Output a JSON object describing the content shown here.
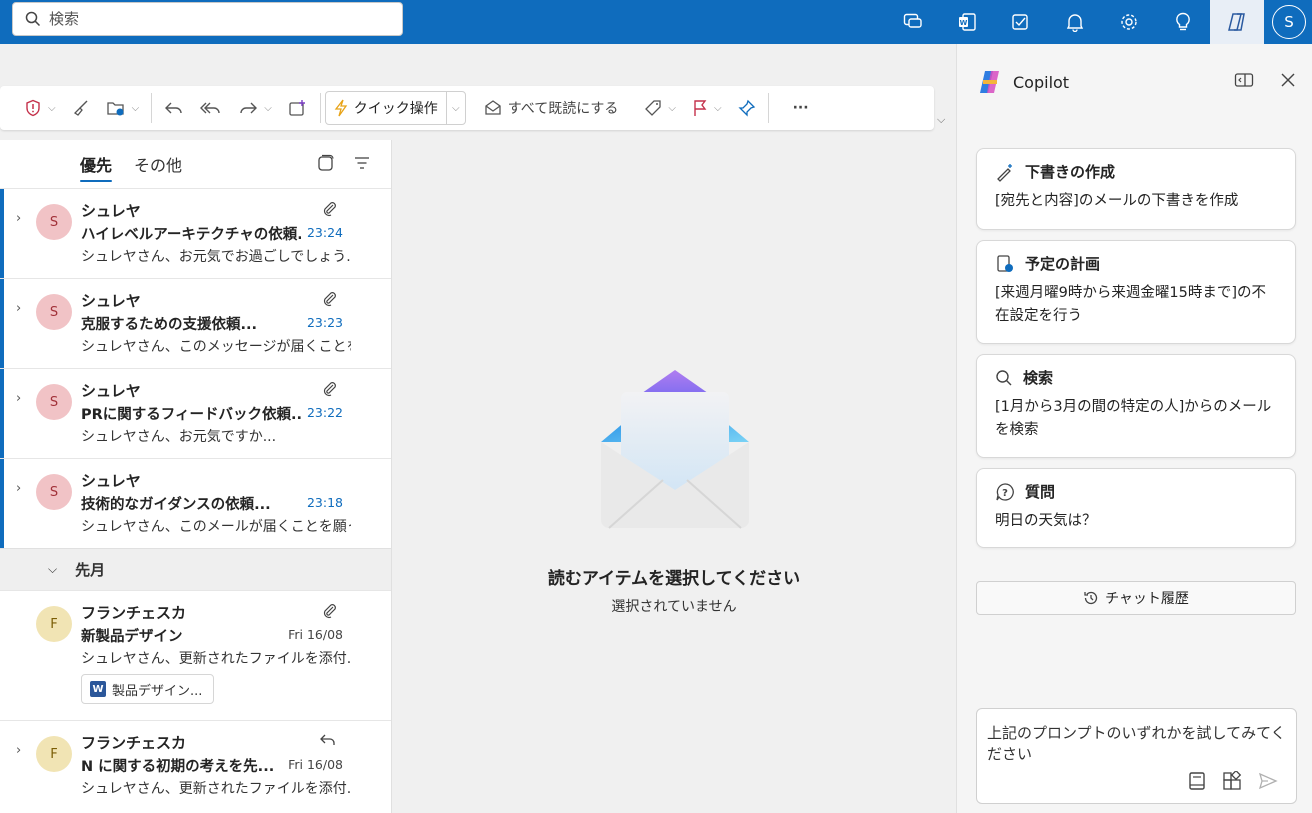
{
  "search": {
    "placeholder": "検索"
  },
  "topbar": {
    "icons": [
      "chat-icon",
      "word-icon",
      "tasks-icon",
      "bell-icon",
      "gear-icon",
      "lightbulb-icon",
      "copilot-icon"
    ],
    "avatar_initial": "S",
    "accent": "#0f6cbd"
  },
  "toolbar": {
    "quick_steps": "クイック操作",
    "mark_all_read": "すべて既読にする",
    "more": "···"
  },
  "list": {
    "tabs": [
      "優先",
      "その他"
    ],
    "group_label": "先月",
    "emails": [
      {
        "initial": "S",
        "sender": "シュレヤ",
        "subject": "ハイレベルアーキテクチャの依頼...",
        "time": "23:24",
        "preview": "シュレヤさん、お元気でお過ごしでしょう..."
      },
      {
        "initial": "S",
        "sender": "シュレヤ",
        "subject": "克服するための支援依頼...",
        "time": "23:23",
        "preview": "シュレヤさん、このメッセージが届くことを..."
      },
      {
        "initial": "S",
        "sender": "シュレヤ",
        "subject": "PRに関するフィードバック依頼...",
        "time": "23:22",
        "preview": "シュレヤさん、お元気ですか..."
      },
      {
        "initial": "S",
        "sender": "シュレヤ",
        "subject": "技術的なガイダンスの依頼...",
        "time": "23:18",
        "preview": "シュレヤさん、このメールが届くことを願っ..."
      },
      {
        "initial": "F",
        "sender": "フランチェスカ",
        "subject": "新製品デザイン",
        "time": "Fri 16/08",
        "preview": "シュレヤさん、更新されたファイルを添付...",
        "attachment": "製品デザイン..."
      },
      {
        "initial": "F",
        "sender": "フランチェスカ",
        "subject": "N に関する初期の考えを先...",
        "time": "Fri 16/08",
        "preview": "シュレヤさん、更新されたファイルを添付..."
      }
    ]
  },
  "reading": {
    "title": "読むアイテムを選択してください",
    "subtitle": "選択されていません"
  },
  "copilot": {
    "title": "Copilot",
    "cards": [
      {
        "title": "下書きの作成",
        "desc": "[宛先と内容]のメールの下書きを作成"
      },
      {
        "title": "予定の計画",
        "desc": "[来週月曜9時から来週金曜15時まで]の不在設定を行う"
      },
      {
        "title": "検索",
        "desc": "[1月から3月の間の特定の人]からのメールを検索"
      },
      {
        "title": "質問",
        "desc": "明日の天気は？"
      }
    ],
    "history": "チャット履歴",
    "prompt_placeholder": "上記のプロンプトのいずれかを試してみてください"
  }
}
